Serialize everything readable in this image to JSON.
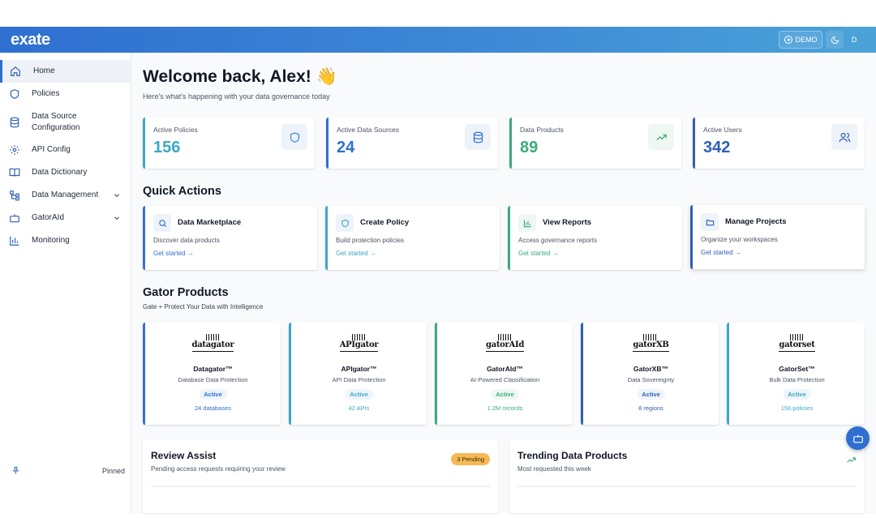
{
  "header": {
    "logo": "exate",
    "demo_label": "DEMO",
    "avatar_initial": "D"
  },
  "sidebar": {
    "items": [
      {
        "label": "Home",
        "icon": "home-icon",
        "active": true
      },
      {
        "label": "Policies",
        "icon": "shield-icon"
      },
      {
        "label": "Data Source Configuration",
        "icon": "database-icon"
      },
      {
        "label": "API Config",
        "icon": "gear-icon"
      },
      {
        "label": "Data Dictionary",
        "icon": "book-icon"
      },
      {
        "label": "Data Management",
        "icon": "hierarchy-icon",
        "expandable": true
      },
      {
        "label": "GatorAId",
        "icon": "bot-icon",
        "expandable": true
      },
      {
        "label": "Monitoring",
        "icon": "bar-chart-icon"
      }
    ],
    "pinned_label": "Pinned"
  },
  "main": {
    "welcome_title": "Welcome back, Alex! 👋",
    "welcome_subtitle": "Here's what's happening with your data governance today",
    "stats": [
      {
        "label": "Active Policies",
        "value": "156",
        "color": "#3ba7c7",
        "icon": "shield-icon"
      },
      {
        "label": "Active Data Sources",
        "value": "24",
        "color": "#2f6fd1",
        "icon": "database-icon"
      },
      {
        "label": "Data Products",
        "value": "89",
        "color": "#3bab7a",
        "icon": "trending-up-icon"
      },
      {
        "label": "Active Users",
        "value": "342",
        "color": "#2f5fb3",
        "icon": "users-icon"
      }
    ],
    "quick_actions_title": "Quick Actions",
    "quick_actions": [
      {
        "title": "Data Marketplace",
        "desc": "Discover data products",
        "link": "Get started",
        "icon": "search-icon",
        "accent": "#3b6fd1"
      },
      {
        "title": "Create Policy",
        "desc": "Build protection policies",
        "link": "Get started",
        "icon": "shield-icon",
        "accent": "#3ba7c7"
      },
      {
        "title": "View Reports",
        "desc": "Access governance reports",
        "link": "Get started",
        "icon": "bar-chart-icon",
        "accent": "#3bab7a"
      },
      {
        "title": "Manage Projects",
        "desc": "Organize your workspaces",
        "link": "Get started",
        "icon": "folder-icon",
        "accent": "#2f5fb3"
      }
    ],
    "products_title": "Gator Products",
    "products_subtitle": "Gate + Protect Your Data with Intelligence",
    "products": [
      {
        "logo": "datagator",
        "name": "Datagator™",
        "desc": "Database Data Protection",
        "status": "Active",
        "metric": "24 databases",
        "accent": "#3b6fd1",
        "metric_color": "#2f6fd1"
      },
      {
        "logo": "APIgator",
        "name": "APIgator™",
        "desc": "API Data Protection",
        "status": "Active",
        "metric": "42 APIs",
        "accent": "#3ba7c7",
        "metric_color": "#3ba7c7"
      },
      {
        "logo": "gatorAId",
        "name": "GatorAId™",
        "desc": "AI-Powered Classification",
        "status": "Active",
        "metric": "1.2M records",
        "accent": "#3bab7a",
        "metric_color": "#3bab7a"
      },
      {
        "logo": "gatorXB",
        "name": "GatorXB™",
        "desc": "Data Sovereignty",
        "status": "Active",
        "metric": "8 regions",
        "accent": "#2f5fb3",
        "metric_color": "#2f5fb3"
      },
      {
        "logo": "gatorset",
        "name": "GatorSet™",
        "desc": "Bulk Data Protection",
        "status": "Active",
        "metric": "156 policies",
        "accent": "#3ba7c7",
        "metric_color": "#3ba7c7"
      }
    ],
    "review_assist": {
      "title": "Review Assist",
      "subtitle": "Pending access requests requiring your review",
      "badge": "3 Pending"
    },
    "trending": {
      "title": "Trending Data Products",
      "subtitle": "Most requested this week"
    }
  }
}
